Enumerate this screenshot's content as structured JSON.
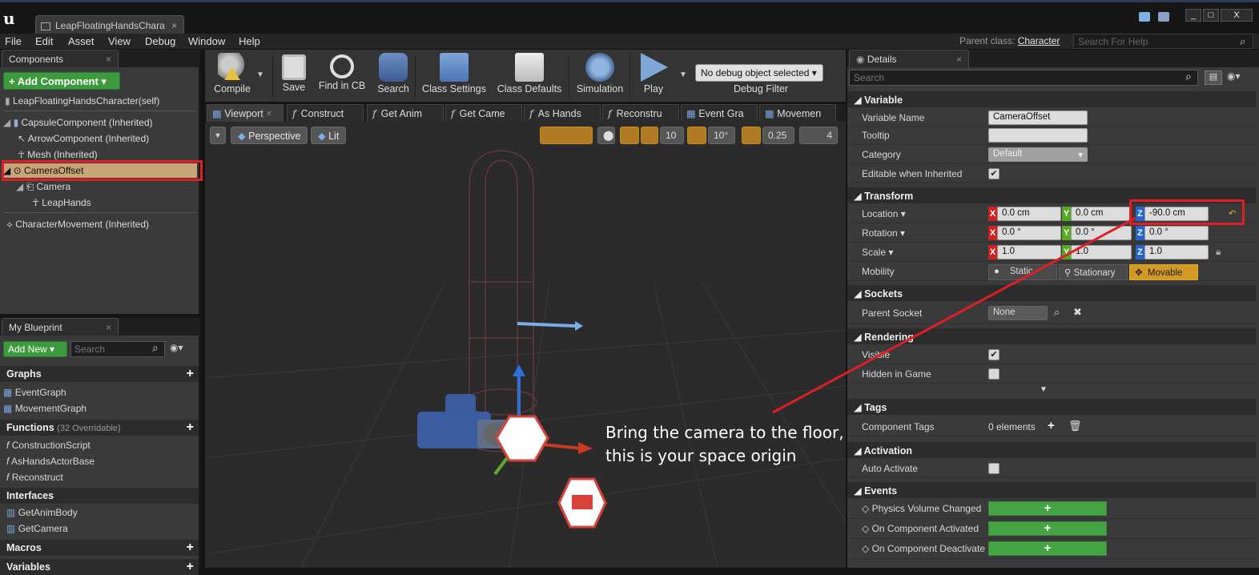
{
  "window": {
    "tab_title": "LeapFloatingHandsChara",
    "minimize": "_",
    "maximize": "□",
    "close": "X"
  },
  "menu": [
    "File",
    "Edit",
    "Asset",
    "View",
    "Debug",
    "Window",
    "Help"
  ],
  "parent_class": {
    "label": "Parent class:",
    "value": "Character"
  },
  "help_search": {
    "placeholder": "Search For Help"
  },
  "components": {
    "tab": "Components",
    "add_button": "+ Add Component ▾",
    "self": "LeapFloatingHandsCharacter(self)",
    "items": [
      "CapsuleComponent (Inherited)",
      "ArrowComponent (Inherited)",
      "Mesh (Inherited)",
      "CameraOffset",
      "Camera",
      "LeapHands",
      "CharacterMovement (Inherited)"
    ]
  },
  "my_blueprint": {
    "tab": "My Blueprint",
    "add_new": "Add New ▾",
    "search_placeholder": "Search",
    "graphs_header": "Graphs",
    "graphs": [
      "EventGraph",
      "MovementGraph"
    ],
    "functions_header": "Functions",
    "functions_sub": "(32 Overridable)",
    "functions": [
      "ConstructionScript",
      "AsHandsActorBase",
      "Reconstruct"
    ],
    "interfaces_header": "Interfaces",
    "interfaces": [
      "GetAnimBody",
      "GetCamera"
    ],
    "macros_header": "Macros",
    "variables_header": "Variables"
  },
  "toolbar": {
    "compile": "Compile",
    "save": "Save",
    "find_in_cb": "Find in CB",
    "search": "Search",
    "class_settings": "Class Settings",
    "class_defaults": "Class Defaults",
    "simulation": "Simulation",
    "play": "Play",
    "debug_select": "No debug object selected",
    "debug_filter": "Debug Filter"
  },
  "graph_tabs": [
    "Viewport",
    "Construct",
    "Get Anim",
    "Get Came",
    "As Hands",
    "Reconstru",
    "Event Gra",
    "Movemen"
  ],
  "viewport": {
    "perspective": "Perspective",
    "lit": "Lit",
    "grid_snap": "10",
    "rot_snap": "10°",
    "scale_snap": "0.25",
    "cam_speed": "4",
    "annotation_line1": "Bring the camera to the floor,",
    "annotation_line2": "this is your space origin"
  },
  "details": {
    "tab": "Details",
    "search_placeholder": "Search",
    "sections": {
      "variable": "Variable",
      "transform": "Transform",
      "sockets": "Sockets",
      "rendering": "Rendering",
      "tags": "Tags",
      "activation": "Activation",
      "events": "Events"
    },
    "variable_name_label": "Variable Name",
    "variable_name": "CameraOffset",
    "tooltip_label": "Tooltip",
    "tooltip_value": "",
    "category_label": "Category",
    "category_value": "Default",
    "editable_inherited_label": "Editable when Inherited",
    "location_label": "Location ▾",
    "loc_x": "0.0 cm",
    "loc_y": "0.0 cm",
    "loc_z": "-90.0 cm",
    "rotation_label": "Rotation ▾",
    "rot_x": "0.0 °",
    "rot_y": "0.0 °",
    "rot_z": "0.0 °",
    "scale_label": "Scale ▾",
    "scale_x": "1.0",
    "scale_y": "1.0",
    "scale_z": "1.0",
    "mobility_label": "Mobility",
    "mobility_static": "Static",
    "mobility_stationary": "Stationary",
    "mobility_movable": "Movable",
    "parent_socket_label": "Parent Socket",
    "parent_socket_value": "None",
    "visible_label": "Visible",
    "hidden_label": "Hidden in Game",
    "component_tags_label": "Component Tags",
    "component_tags_value": "0 elements",
    "auto_activate_label": "Auto Activate",
    "events": [
      "Physics Volume Changed",
      "On Component Activated",
      "On Component Deactivate"
    ],
    "event_add": "+"
  },
  "colors": {
    "highlight_red": "#e01e25",
    "green": "#45a545",
    "selection": "#c8a477"
  }
}
